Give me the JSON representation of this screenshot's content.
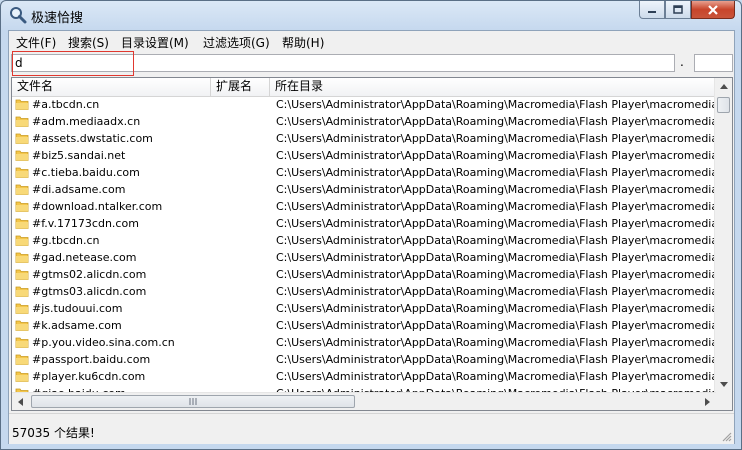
{
  "window": {
    "title": "极速恰搜"
  },
  "menu": [
    {
      "label": "文件(F)"
    },
    {
      "label": "搜索(S)"
    },
    {
      "label": "目录设置(M)"
    },
    {
      "label": "过滤选项(G)"
    },
    {
      "label": "帮助(H)"
    }
  ],
  "search": {
    "value": "d",
    "separator": "."
  },
  "columns": {
    "name": "文件名",
    "ext": "扩展名",
    "dir": "所在目录"
  },
  "rows": [
    {
      "name": "#a.tbcdn.cn",
      "path": "C:\\Users\\Administrator\\AppData\\Roaming\\Macromedia\\Flash Player\\macromedia.com\\suppo"
    },
    {
      "name": "#adm.mediaadx.cn",
      "path": "C:\\Users\\Administrator\\AppData\\Roaming\\Macromedia\\Flash Player\\macromedia.com\\suppo"
    },
    {
      "name": "#assets.dwstatic.com",
      "path": "C:\\Users\\Administrator\\AppData\\Roaming\\Macromedia\\Flash Player\\macromedia.com\\suppo"
    },
    {
      "name": "#biz5.sandai.net",
      "path": "C:\\Users\\Administrator\\AppData\\Roaming\\Macromedia\\Flash Player\\macromedia.com\\suppo"
    },
    {
      "name": "#c.tieba.baidu.com",
      "path": "C:\\Users\\Administrator\\AppData\\Roaming\\Macromedia\\Flash Player\\macromedia.com\\suppo"
    },
    {
      "name": "#di.adsame.com",
      "path": "C:\\Users\\Administrator\\AppData\\Roaming\\Macromedia\\Flash Player\\macromedia.com\\suppo"
    },
    {
      "name": "#download.ntalker.com",
      "path": "C:\\Users\\Administrator\\AppData\\Roaming\\Macromedia\\Flash Player\\macromedia.com\\suppo"
    },
    {
      "name": "#f.v.17173cdn.com",
      "path": "C:\\Users\\Administrator\\AppData\\Roaming\\Macromedia\\Flash Player\\macromedia.com\\suppo"
    },
    {
      "name": "#g.tbcdn.cn",
      "path": "C:\\Users\\Administrator\\AppData\\Roaming\\Macromedia\\Flash Player\\macromedia.com\\suppo"
    },
    {
      "name": "#gad.netease.com",
      "path": "C:\\Users\\Administrator\\AppData\\Roaming\\Macromedia\\Flash Player\\macromedia.com\\suppo"
    },
    {
      "name": "#gtms02.alicdn.com",
      "path": "C:\\Users\\Administrator\\AppData\\Roaming\\Macromedia\\Flash Player\\macromedia.com\\suppo"
    },
    {
      "name": "#gtms03.alicdn.com",
      "path": "C:\\Users\\Administrator\\AppData\\Roaming\\Macromedia\\Flash Player\\macromedia.com\\suppo"
    },
    {
      "name": "#js.tudouui.com",
      "path": "C:\\Users\\Administrator\\AppData\\Roaming\\Macromedia\\Flash Player\\macromedia.com\\suppo"
    },
    {
      "name": "#k.adsame.com",
      "path": "C:\\Users\\Administrator\\AppData\\Roaming\\Macromedia\\Flash Player\\macromedia.com\\suppo"
    },
    {
      "name": "#p.you.video.sina.com.cn",
      "path": "C:\\Users\\Administrator\\AppData\\Roaming\\Macromedia\\Flash Player\\macromedia.com\\suppo"
    },
    {
      "name": "#passport.baidu.com",
      "path": "C:\\Users\\Administrator\\AppData\\Roaming\\Macromedia\\Flash Player\\macromedia.com\\suppo"
    },
    {
      "name": "#player.ku6cdn.com",
      "path": "C:\\Users\\Administrator\\AppData\\Roaming\\Macromedia\\Flash Player\\macromedia.com\\suppo"
    },
    {
      "name": "#qiao.baidu.com",
      "path": "C:\\Users\\Administrator\\AppData\\Roaming\\Macromedia\\Flash Player\\macromedia.com\\suppo"
    }
  ],
  "status": {
    "text": "57035 个结果!"
  },
  "colors": {
    "folder": "#f4c64a",
    "close_button": "#c9553a",
    "focus_outline": "#e0382f"
  }
}
